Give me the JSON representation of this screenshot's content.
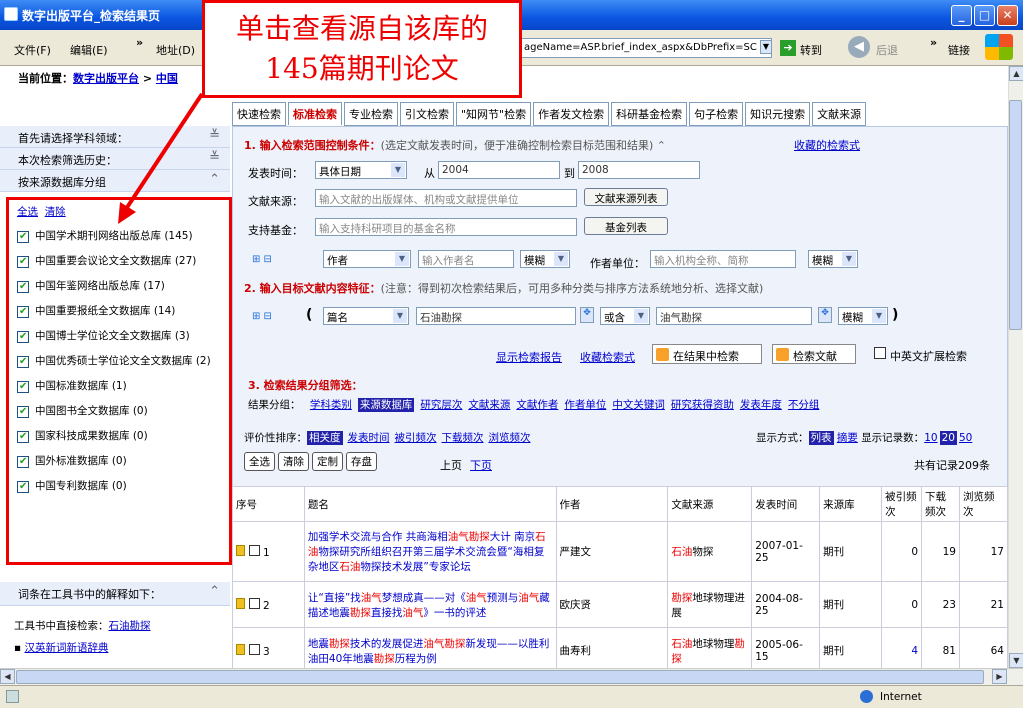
{
  "window": {
    "title": "数字出版平台_检索结果页"
  },
  "menu": {
    "file": "文件(F)",
    "edit": "编辑(E)",
    "more": "»",
    "address_prefix": "地址(D)",
    "go": "转到",
    "back": "后退",
    "links": "链接"
  },
  "address": {
    "value": "ageName=ASP.brief_index_aspx&DbPrefix=SC"
  },
  "callout": {
    "line1": "单击查看源自该库的",
    "line2": "145篇期刊论文"
  },
  "location": {
    "label": "当前位置：",
    "crumb1": "数字出版平台",
    "sep": ">",
    "crumb2": "中国"
  },
  "tabs": [
    "快速检索",
    "标准检索",
    "专业检索",
    "引文检索",
    "\"知网节\"检索",
    "作者发文检索",
    "科研基金检索",
    "句子检索",
    "知识元搜索",
    "文献来源"
  ],
  "sidebar": {
    "h1": "首先请选择学科领域：",
    "h2": "本次检索筛选历史：",
    "h3": "按来源数据库分组",
    "select_all": "全选",
    "clear": "清除",
    "dbs": [
      {
        "label": "中国学术期刊网络出版总库 (145)"
      },
      {
        "label": "中国重要会议论文全文数据库 (27)"
      },
      {
        "label": "中国年鉴网络出版总库 (17)"
      },
      {
        "label": "中国重要报纸全文数据库 (14)"
      },
      {
        "label": "中国博士学位论文全文数据库 (3)"
      },
      {
        "label": "中国优秀硕士学位论文全文数据库 (2)"
      },
      {
        "label": "中国标准数据库 (1)"
      },
      {
        "label": "中国图书全文数据库 (0)"
      },
      {
        "label": "国家科技成果数据库 (0)"
      },
      {
        "label": "国外标准数据库 (0)"
      },
      {
        "label": "中国专利数据库 (0)"
      }
    ],
    "tool_head": "词条在工具书中的解释如下：",
    "tool_direct": "工具书中直接检索：",
    "tool_term": "石油勘探",
    "tool_link": "汉英新词新语辞典"
  },
  "section1": {
    "title": "1. 输入检索范围控制条件：",
    "note": "(选定文献发表时间，便于准确控制检索目标范围和结果)",
    "fav": "收藏的检索式",
    "time_label": "发表时间：",
    "time_type": "具体日期",
    "from": "从",
    "from_val": "2004",
    "to": "到",
    "to_val": "2008",
    "src_label": "文献来源：",
    "src_ph": "输入文献的出版媒体、机构或文献提供单位",
    "src_btn": "文献来源列表",
    "fund_label": "支持基金：",
    "fund_ph": "输入支持科研项目的基金名称",
    "fund_btn": "基金列表",
    "author_sel": "作者",
    "author_ph": "输入作者名",
    "fuzzy": "模糊",
    "unit_label": "作者单位：",
    "unit_ph": "输入机构全称、简称"
  },
  "section2": {
    "title": "2. 输入目标文献内容特征：",
    "note": "(注意：得到初次检索结果后，可用多种分类与排序方法系统地分析、选择文献)",
    "field": "篇名",
    "term1": "石油勘探",
    "op": "或含",
    "term2": "油气勘探",
    "fuzzy": "模糊",
    "report": "显示检索报告",
    "save": "收藏检索式",
    "search_in": "在结果中检索",
    "search": "检索文献",
    "expand": "中英文扩展检索"
  },
  "section3": {
    "title": "3. 检索结果分组筛选：",
    "group_label": "结果分组：",
    "groups": [
      "学科类别",
      "来源数据库",
      "研究层次",
      "文献来源",
      "文献作者",
      "作者单位",
      "中文关键词",
      "研究获得资助",
      "发表年度",
      "不分组"
    ],
    "sort_label": "评价性排序：",
    "sorts": [
      "相关度",
      "发表时间",
      "被引频次",
      "下载频次",
      "浏览频次"
    ],
    "display_label": "显示方式：",
    "display_list": "列表",
    "display_abs": "摘要",
    "per_page_label": "显示记录数：",
    "pp": [
      "10",
      "20",
      "50"
    ],
    "btns": [
      "全选",
      "清除",
      "定制",
      "存盘"
    ],
    "prev": "上页",
    "next": "下页",
    "total": "共有记录209条"
  },
  "table": {
    "headers": [
      "序号",
      "题名",
      "作者",
      "文献来源",
      "发表时间",
      "来源库",
      "被引频次",
      "下载频次",
      "浏览频次"
    ],
    "rows": [
      {
        "no": "1",
        "title": "加强学术交流与合作 共商海相油气勘探大计 南京石油物探研究所组织召开第三届学术交流会暨“海相复杂地区石油物探技术发展”专家论坛",
        "author": "严建文",
        "source": "石油物探",
        "date": "2007-01-25",
        "db": "期刊",
        "cite": "0",
        "dl": "19",
        "view": "17"
      },
      {
        "no": "2",
        "title": "让“直接”找油气梦想成真——对《油气预测与油气藏描述地震勘探直接找油气》一书的评述",
        "author": "欧庆贤",
        "source": "勘探地球物理进展",
        "date": "2004-08-25",
        "db": "期刊",
        "cite": "0",
        "dl": "23",
        "view": "21"
      },
      {
        "no": "3",
        "title": "地震勘探技术的发展促进油气勘探新发现——以胜利油田40年地震勘探历程为例",
        "author": "曲寿利",
        "source": "石油地球物理勘探",
        "date": "2005-06-15",
        "db": "期刊",
        "cite": "4",
        "dl": "81",
        "view": "64"
      }
    ]
  },
  "status": {
    "zone": "Internet"
  },
  "colors": {
    "titlebar": "#0a55e0",
    "callout": "#e00000",
    "accent_red": "#cc0000",
    "link": "#0000cc"
  }
}
